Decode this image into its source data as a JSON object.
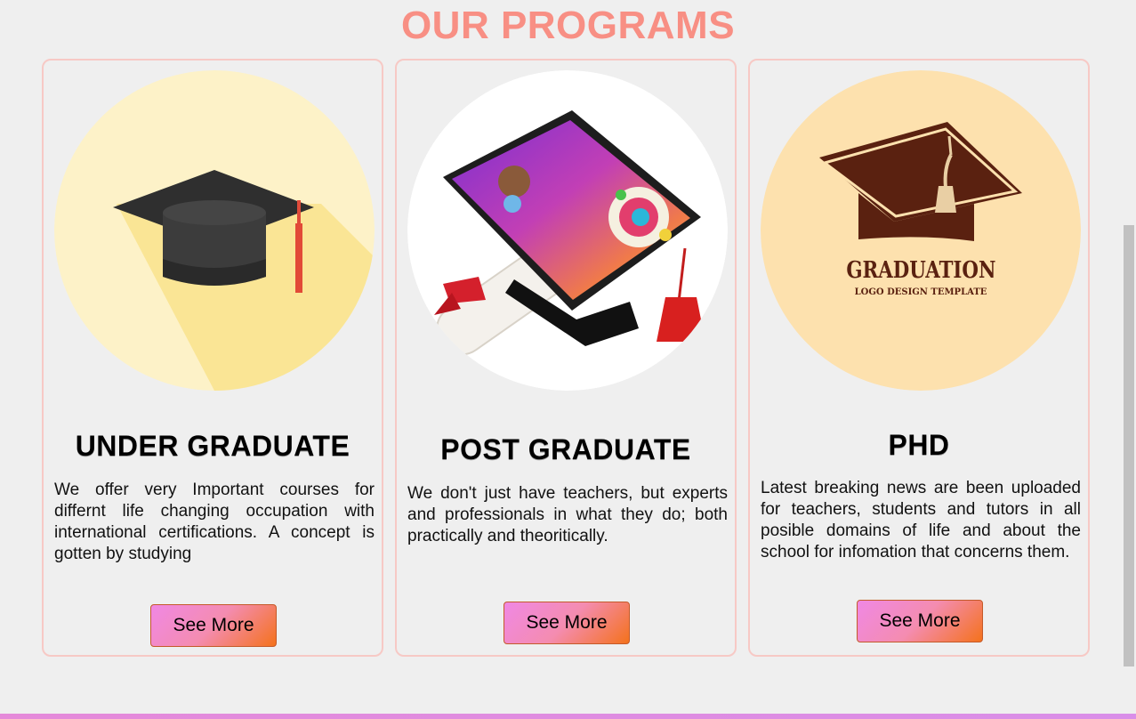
{
  "section": {
    "title": "OUR PROGRAMS"
  },
  "programs": [
    {
      "title": "UNDER GRADUATE",
      "description": "We offer very Important courses for differnt life changing occupation with international certifications. A concept is gotten by studying",
      "button_label": "See More",
      "image_icon": "graduation-cap-icon"
    },
    {
      "title": "POST GRADUATE",
      "description": "We don't just have teachers, but experts and professionals in what they do; both practically and theoritically.",
      "button_label": "See More",
      "image_icon": "graduation-cap-diploma-icon"
    },
    {
      "title": "PHD",
      "description": "Latest breaking news are been uploaded for teachers, students and tutors in all posible domains of life and about the school for infomation that concerns them.",
      "button_label": "See More",
      "image_icon": "graduation-logo-icon",
      "logo_text": "GRADUATION",
      "logo_subtext": "LOGO DESIGN TEMPLATE"
    }
  ],
  "colors": {
    "title": "#f88f84",
    "card_border": "#f7c9c5",
    "background": "#efefef",
    "button_gradient_start": "#f088e4",
    "button_gradient_end": "#f4721c"
  }
}
